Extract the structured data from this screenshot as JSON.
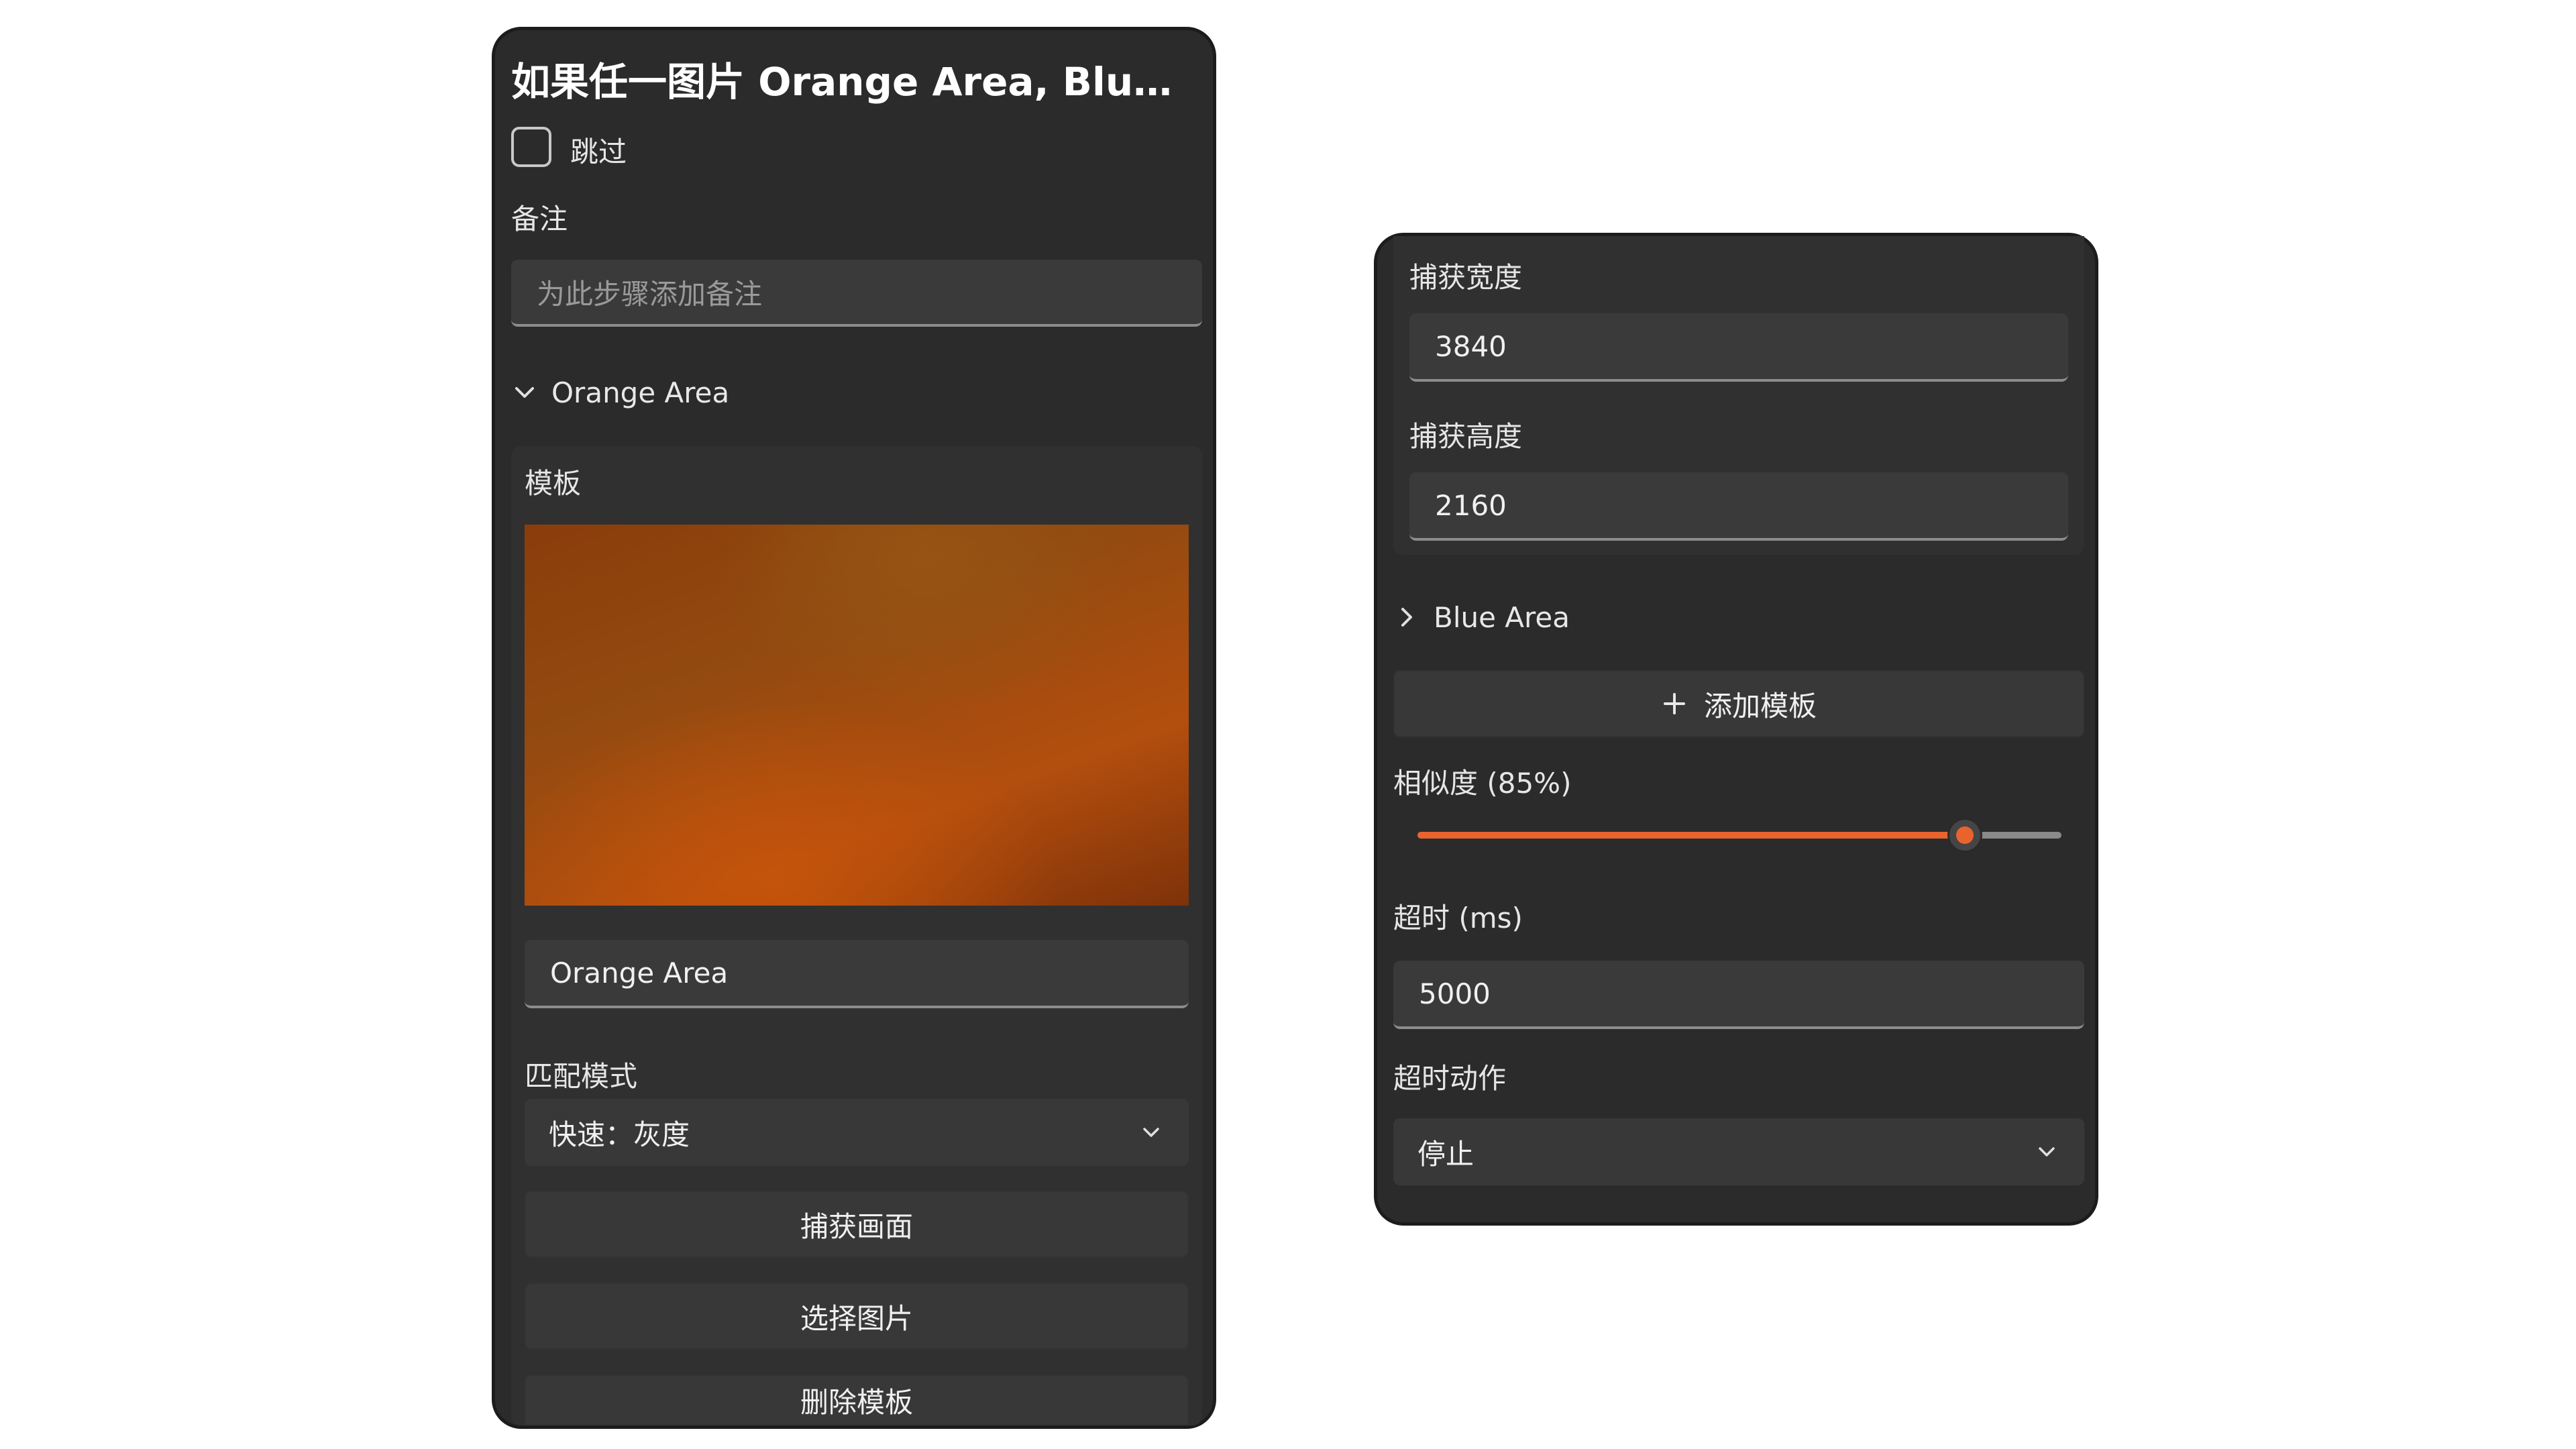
{
  "left": {
    "title": "如果任一图片 Orange Area, Blue Ar...",
    "skip_label": "跳过",
    "skip_checked": false,
    "note_label": "备注",
    "note_placeholder": "为此步骤添加备注",
    "expander_label": "Orange Area",
    "expander_icon": "chevron-down-icon",
    "template_label": "模板",
    "template_name": "Orange Area",
    "match_mode_label": "匹配模式",
    "match_mode_value": "快速：灰度",
    "capture_button": "捕获画面",
    "select_image_button": "选择图片",
    "delete_template_button": "删除模板"
  },
  "right": {
    "capture_width_label": "捕获宽度",
    "capture_width_value": "3840",
    "capture_height_label": "捕获高度",
    "capture_height_value": "2160",
    "blue_area_label": "Blue Area",
    "blue_area_icon": "chevron-right-icon",
    "add_template_button": "添加模板",
    "add_icon": "plus-icon",
    "similarity_label": "相似度 (85%)",
    "similarity_percent": 85,
    "timeout_label": "超时 (ms)",
    "timeout_value": "5000",
    "timeout_action_label": "超时动作",
    "timeout_action_value": "停止"
  },
  "colors": {
    "panel_bg": "#2b2b2b",
    "accent": "#e8642c",
    "track_bg": "#8a8a8a"
  }
}
